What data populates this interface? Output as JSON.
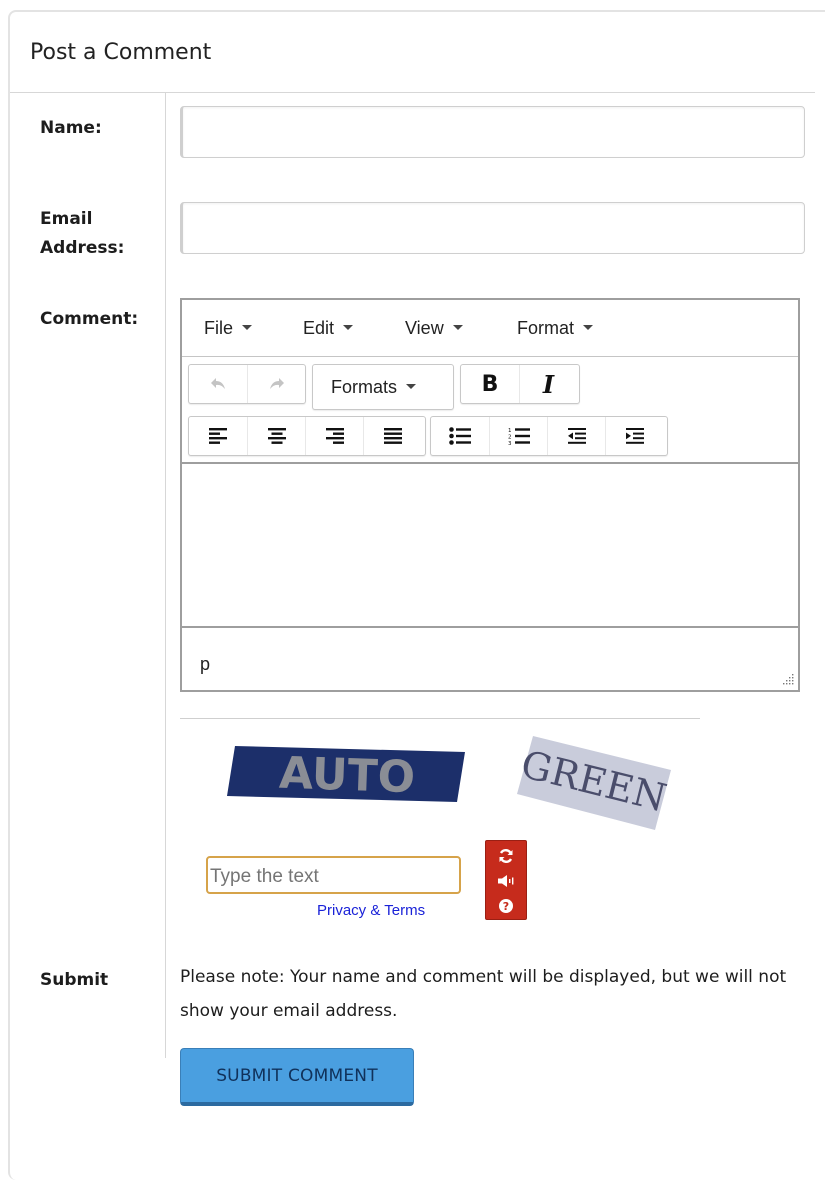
{
  "panel": {
    "title": "Post a Comment"
  },
  "labels": {
    "name": "Name:",
    "email_line1": "Email",
    "email_line2": "Address:",
    "comment": "Comment:",
    "submit": "Submit"
  },
  "fields": {
    "name_value": "",
    "email_value": ""
  },
  "editor": {
    "menu": [
      "File",
      "Edit",
      "View",
      "Format"
    ],
    "formats_label": "Formats",
    "toolbar_icons": [
      "undo-icon",
      "redo-icon",
      "bold-icon",
      "italic-icon",
      "align-left-icon",
      "align-center-icon",
      "align-right-icon",
      "align-justify-icon",
      "bullet-list-icon",
      "numbered-list-icon",
      "outdent-icon",
      "indent-icon"
    ],
    "path": "p",
    "content": ""
  },
  "captcha": {
    "word1": "AUTO",
    "word2": "GREEN",
    "placeholder": "Type the text",
    "privacy_link": "Privacy & Terms",
    "icons": [
      "refresh-icon",
      "audio-icon",
      "help-icon"
    ],
    "brand_color": "#c62b1c"
  },
  "note": "Please note: Your name and comment will be displayed, but we will not show your email address.",
  "submit_button": "SUBMIT COMMENT",
  "colors": {
    "submit_bg": "#4a9fe0",
    "captcha_border": "#d6a34a",
    "link": "#1a22d8"
  }
}
